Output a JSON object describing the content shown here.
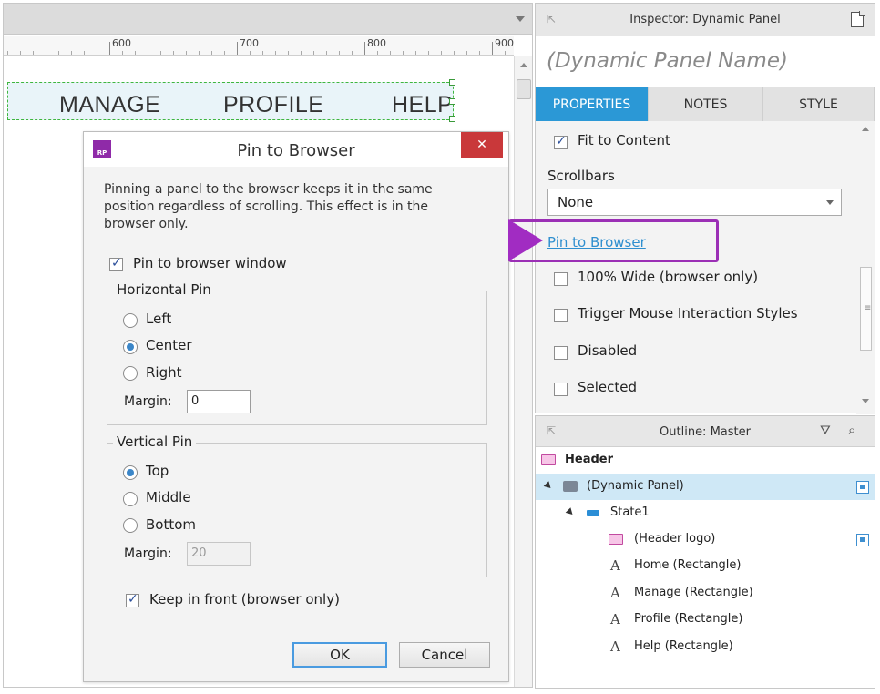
{
  "canvas": {
    "ruler_labels": [
      "600",
      "700",
      "800",
      "900"
    ],
    "menu_items": [
      "MANAGE",
      "PROFILE",
      "HELP"
    ]
  },
  "dialog": {
    "icon_text": "RP",
    "title": "Pin to Browser",
    "close_glyph": "✕",
    "description": "Pinning a panel to the browser keeps it in the same position regardless of scrolling. This effect is in the browser only.",
    "pin_checkbox": "Pin to browser window",
    "horizontal": {
      "legend": "Horizontal Pin",
      "options": [
        "Left",
        "Center",
        "Right"
      ],
      "selected": "Center",
      "margin_label": "Margin:",
      "margin_value": "0"
    },
    "vertical": {
      "legend": "Vertical Pin",
      "options": [
        "Top",
        "Middle",
        "Bottom"
      ],
      "selected": "Top",
      "margin_label": "Margin:",
      "margin_value": "20"
    },
    "keep_front": "Keep in front (browser only)",
    "ok": "OK",
    "cancel": "Cancel"
  },
  "inspector": {
    "title": "Inspector: Dynamic Panel",
    "panel_name_placeholder": "(Dynamic Panel Name)",
    "tabs": [
      "PROPERTIES",
      "NOTES",
      "STYLE"
    ],
    "active_tab": "PROPERTIES",
    "fit_to_content": "Fit to Content",
    "scrollbars_label": "Scrollbars",
    "scrollbars_value": "None",
    "pin_link": "Pin to Browser",
    "wide": "100% Wide (browser only)",
    "trigger": "Trigger Mouse Interaction Styles",
    "disabled": "Disabled",
    "selected": "Selected",
    "highlight_color": "#9b2fb5"
  },
  "outline": {
    "title": "Outline: Master",
    "rows": [
      {
        "label": "Header",
        "icon": "master-icon"
      },
      {
        "label": "(Dynamic Panel)",
        "icon": "dynamic-panel-icon"
      },
      {
        "label": "State1",
        "icon": "state-icon"
      },
      {
        "label": "(Header logo)",
        "icon": "master-icon"
      },
      {
        "label": "Home (Rectangle)",
        "icon": "text-icon"
      },
      {
        "label": "Manage (Rectangle)",
        "icon": "text-icon"
      },
      {
        "label": "Profile (Rectangle)",
        "icon": "text-icon"
      },
      {
        "label": "Help (Rectangle)",
        "icon": "text-icon"
      }
    ]
  },
  "colors": {
    "accent": "#2b98d6",
    "close_red": "#c9383a",
    "brand_purple": "#8f2aa8"
  }
}
